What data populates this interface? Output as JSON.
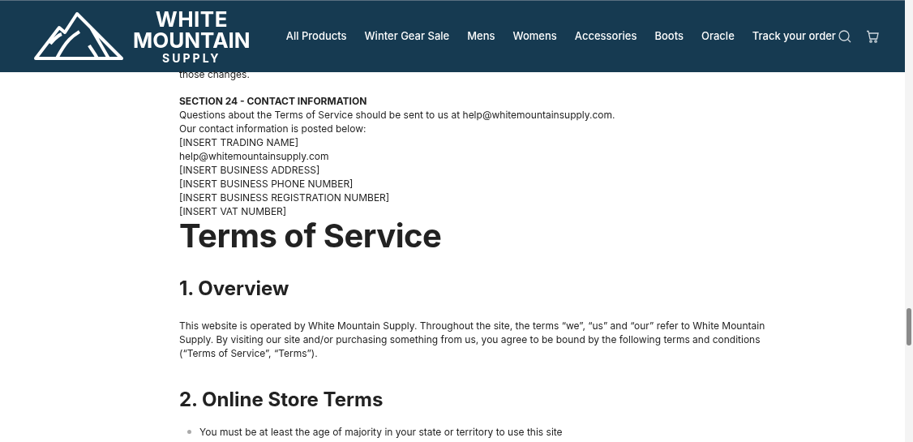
{
  "header": {
    "logo": {
      "line_1": "WHITE",
      "line_2": "MOUNTAIN",
      "line_3": "SUPPLY"
    },
    "nav": [
      "All Products",
      "Winter Gear Sale",
      "Mens",
      "Womens",
      "Accessories",
      "Boots",
      "Oracle",
      "Track your order"
    ]
  },
  "content": {
    "cut_line": "those changes.",
    "section_heading": "SECTION 24 - CONTACT INFORMATION",
    "contact_lines": [
      "Questions about the Terms of Service should be sent to us at help@whitemountainsupply.com.",
      "Our contact information is posted below:",
      "[INSERT TRADING NAME]",
      "help@whitemountainsupply.com",
      "[INSERT BUSINESS ADDRESS]",
      "[INSERT BUSINESS PHONE NUMBER]",
      "[INSERT BUSINESS REGISTRATION NUMBER]",
      "[INSERT VAT NUMBER]"
    ],
    "title": "Terms of Service",
    "overview_heading": "1. Overview",
    "overview_text": "This website is operated by White Mountain Supply. Throughout the site, the terms “we”, “us” and “our” refer to White Mountain Supply. By visiting our site and/or purchasing something from us, you agree to be bound by the following terms and conditions (“Terms of Service”, “Terms”).",
    "store_heading": "2. Online Store Terms",
    "store_items": [
      "You must be at least the age of majority in your state or territory to use this site"
    ]
  }
}
